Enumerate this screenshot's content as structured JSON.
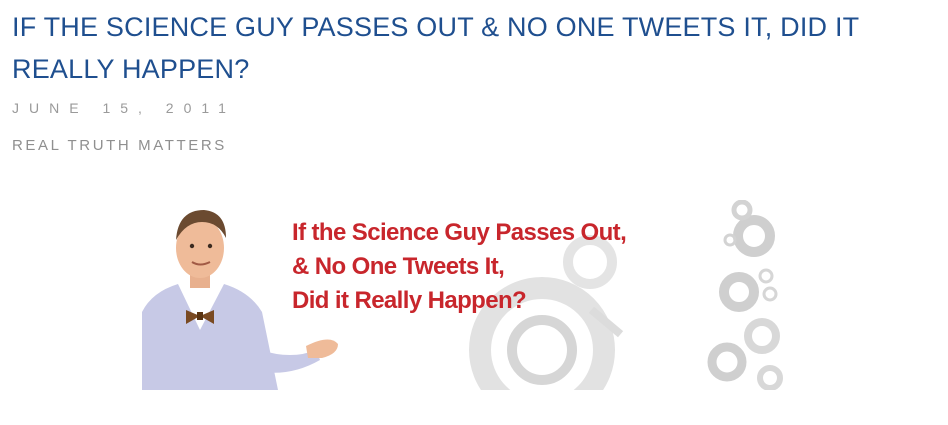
{
  "post": {
    "title": "IF THE SCIENCE GUY PASSES OUT & NO ONE TWEETS IT, DID IT REALLY HAPPEN?",
    "date": "JUNE 15, 2011",
    "category": "REAL TRUTH MATTERS"
  },
  "banner": {
    "lines": [
      "If the Science Guy Passes Out,",
      "& No One Tweets It,",
      "Did it Really Happen?"
    ],
    "text_color": "#c8262c"
  },
  "colors": {
    "title": "#1f4f8f",
    "meta": "#9a9a9a"
  }
}
